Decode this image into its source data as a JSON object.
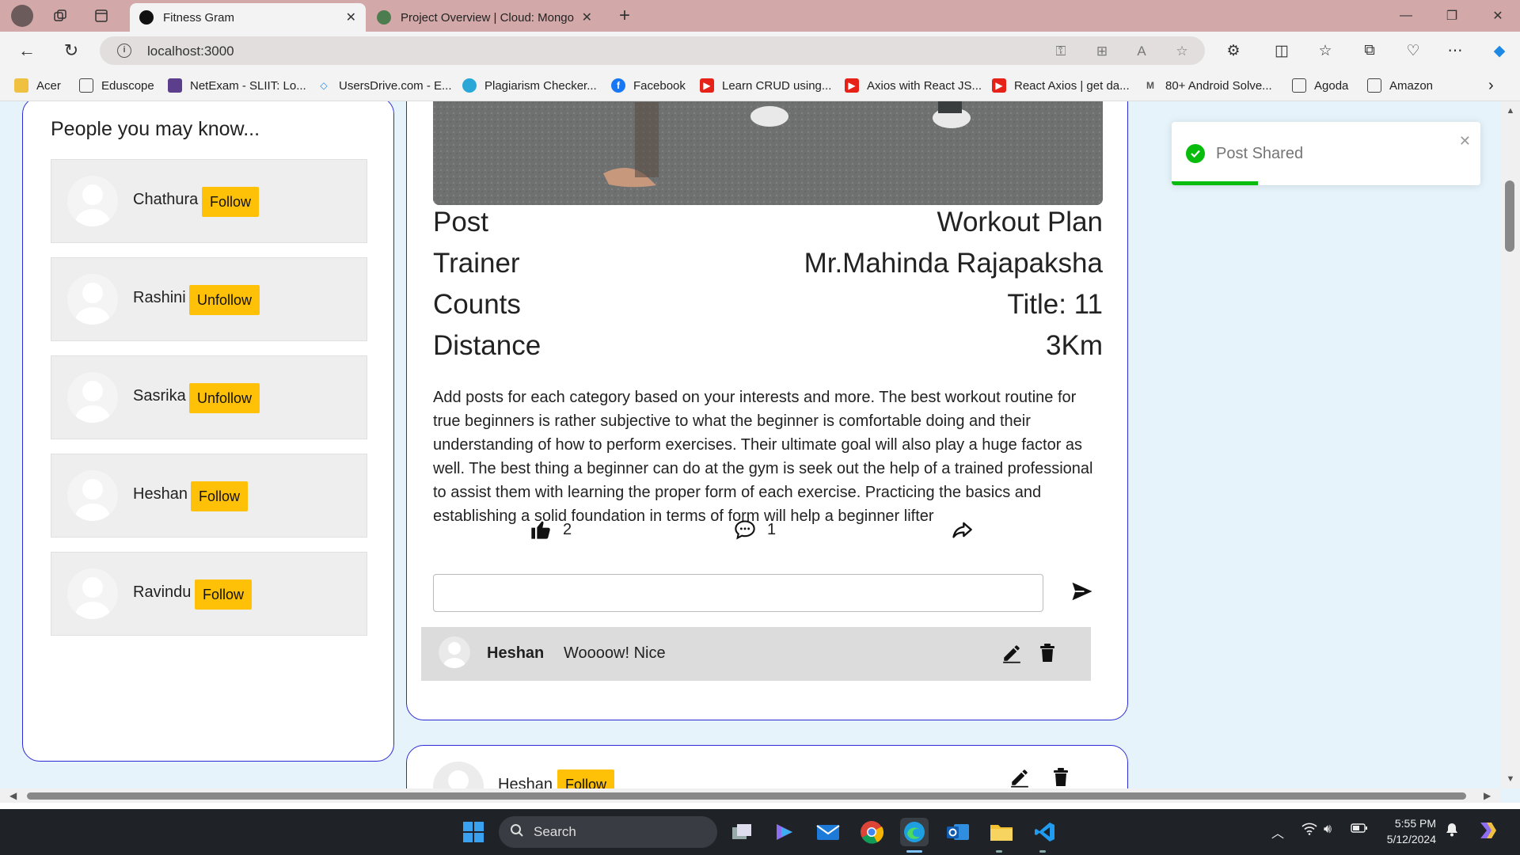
{
  "browser": {
    "tabs": [
      {
        "title": "Fitness Gram"
      },
      {
        "title": "Project Overview | Cloud: Mongo"
      }
    ],
    "url": "localhost:3000",
    "bookmarks": [
      "Acer",
      "Eduscope",
      "NetExam - SLIIT: Lo...",
      "UsersDrive.com - E...",
      "Plagiarism Checker...",
      "Facebook",
      "Learn CRUD using...",
      "Axios with React JS...",
      "React Axios | get da...",
      "80+ Android Solve...",
      "Agoda",
      "Amazon"
    ]
  },
  "people_panel": {
    "title": "People you may know...",
    "people": [
      {
        "name": "Chathura",
        "action": "Follow"
      },
      {
        "name": "Rashini",
        "action": "Unfollow"
      },
      {
        "name": "Sasrika",
        "action": "Unfollow"
      },
      {
        "name": "Heshan",
        "action": "Follow"
      },
      {
        "name": "Ravindu",
        "action": "Follow"
      }
    ]
  },
  "post": {
    "rows": [
      {
        "label": "Post",
        "value": "Workout Plan"
      },
      {
        "label": "Trainer",
        "value": "Mr.Mahinda Rajapaksha"
      },
      {
        "label": "Counts",
        "value": "Title: 11"
      },
      {
        "label": "Distance",
        "value": "3Km"
      }
    ],
    "description": "Add posts for each category based on your interests and more. The best workout routine for true beginners is rather subjective to what the beginner is comfortable doing and their understanding of how to perform exercises. Their ultimate goal will also play a huge factor as well. The best thing a beginner can do at the gym is seek out the help of a trained professional to assist them with learning the proper form of each exercise. Practicing the basics and establishing a solid foundation in terms of form will help a beginner lifter",
    "likes": "2",
    "comments_count": "1",
    "comment_input_value": "",
    "comments": [
      {
        "user": "Heshan",
        "text": "Woooow! Nice"
      }
    ]
  },
  "next_post": {
    "user": "Heshan",
    "action": "Follow"
  },
  "toast": {
    "message": "Post Shared",
    "progress": 0.28,
    "color": "#07bc0c"
  },
  "taskbar": {
    "search_label": "Search",
    "time": "5:55 PM",
    "date": "5/12/2024"
  },
  "colors": {
    "accent_border": "#2b2bd6",
    "follow_button": "#ffc107",
    "page_background": "#e6f3fb",
    "tabbar": "#d3a8a8"
  }
}
